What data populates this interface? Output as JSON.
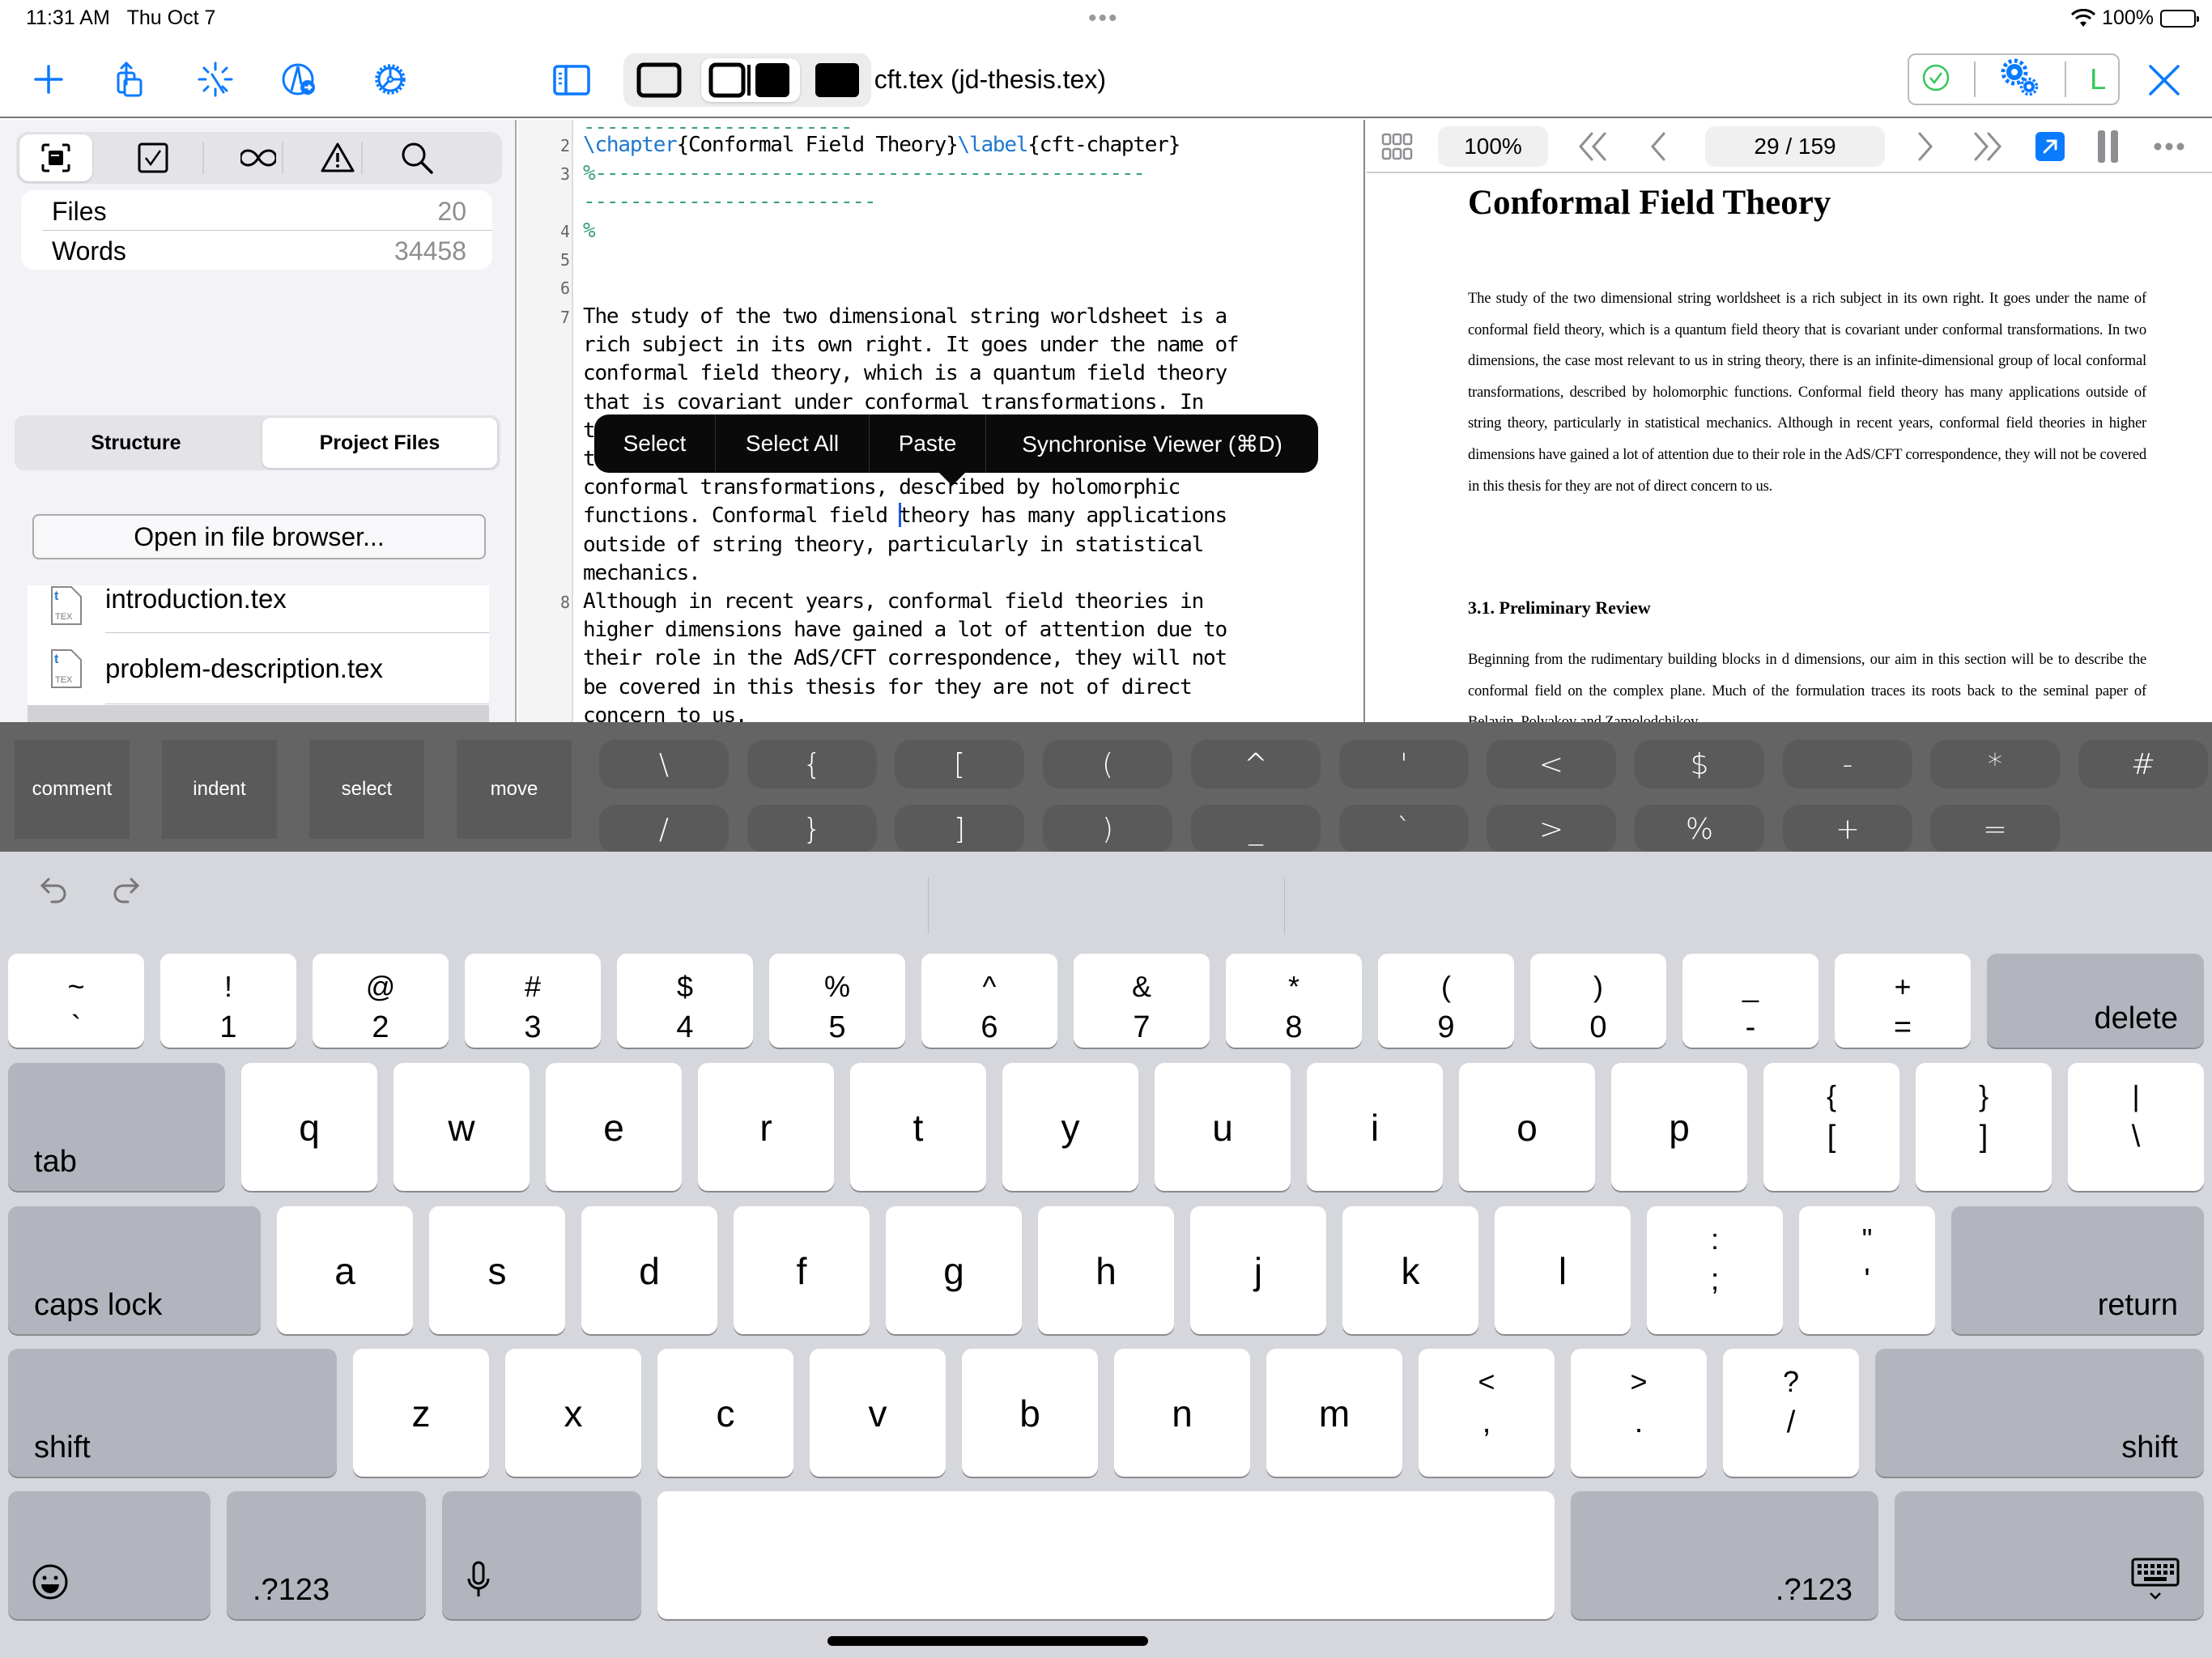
{
  "status_bar": {
    "time": "11:31 AM",
    "date": "Thu Oct 7",
    "battery": "100%",
    "multitask_dots": "•••"
  },
  "toolbar": {
    "left_icons": [
      "plus-icon",
      "share-icon",
      "magic-wand-icon",
      "compass-icon",
      "settings-gear-icon"
    ],
    "sidebar_toggle": "sidebar-icon",
    "layout_modes": [
      "editor-only",
      "split-editor-viewer",
      "viewer-only"
    ],
    "selected_layout": "split-editor-viewer",
    "title": "cft.tex (jd-thesis.tex)",
    "status_group": {
      "compile_status": "checkmark-circle-icon",
      "settings": "gears-icon",
      "engine_label": "L"
    },
    "close": "close-icon",
    "colors": {
      "accent": "#0a7aff",
      "success": "#34c759"
    }
  },
  "sidebar": {
    "segment_icons": [
      "outline-icon",
      "checkbox-icon",
      "infinity-icon",
      "warning-icon",
      "search-icon"
    ],
    "selected_segment": 0,
    "stats": [
      {
        "label": "Files",
        "value": "20"
      },
      {
        "label": "Words",
        "value": "34458"
      }
    ],
    "tabs": [
      {
        "label": "Structure",
        "selected": false
      },
      {
        "label": "Project Files",
        "selected": true
      }
    ],
    "open_button": "Open in file browser...",
    "files": [
      {
        "name": "introduction.tex",
        "icon_label": "TEX"
      },
      {
        "name": "problem-description.tex",
        "icon_label": "TEX"
      }
    ]
  },
  "editor": {
    "line_numbers": [
      "2",
      "3",
      "4",
      "5",
      "6",
      "7",
      "8"
    ],
    "line2": {
      "cmd1": "\\chapter",
      "arg1": "{Conformal Field Theory}",
      "cmd2": "\\label",
      "arg2": "{cft-chapter}"
    },
    "line3_a": "%-----------------------------------------------",
    "line3_b": "-------------------------",
    "line4": "%",
    "line7": [
      "The study of the two dimensional string worldsheet is a",
      "rich subject in its own right. It goes under the name of",
      "conformal field theory, which is a quantum field theory",
      "that is covariant under conformal transformations. In",
      "two dimensions, the case most relevant to us in string",
      "theory, there is an infinite-dimensional group of local",
      "conformal transformations, described by holomorphic"
    ],
    "line7_caret_before": "functions. Conformal field ",
    "line7_caret_after": "theory has many applications",
    "line7_rest": [
      "outside of string theory, particularly in statistical",
      "mechanics."
    ],
    "line8": [
      "Although in recent years, conformal field theories in",
      "higher dimensions have gained a lot of attention due to",
      "their role in the AdS/CFT correspondence, they will not",
      "be covered in this thesis for they are not of direct",
      "concern to us."
    ]
  },
  "context_menu": {
    "items": [
      "Select",
      "Select All",
      "Paste",
      "Synchronise Viewer (⌘D)"
    ]
  },
  "viewer": {
    "zoom": "100%",
    "page_indicator": "29 / 159",
    "nav": [
      "first-page-icon",
      "prev-page-icon",
      "next-page-icon",
      "last-page-icon"
    ],
    "page": {
      "title": "Conformal Field Theory",
      "para1": "The study of the two dimensional string worldsheet is a rich subject in its own right. It goes under the name of conformal field theory, which is a quantum field theory that is covariant under conformal transformations. In two dimensions, the case most relevant to us in string theory, there is an infinite-dimensional group of local conformal transformations, described by holomorphic functions. Conformal field theory has many applications outside of string theory, particularly in statistical mechanics. Although in recent years, conformal field theories in higher dimensions have gained a lot of attention due to their role in the AdS/CFT correspondence, they will not be covered in this thesis for they are not of direct concern to us.",
      "section": "3.1.  Preliminary Review",
      "para2": "Beginning from the rudimentary building blocks in d dimensions, our aim in this section will be to describe the conformal field on the complex plane. Much of the formulation traces its roots back to the seminal paper of Belavin, Polyakov and Zamolodchikov"
    }
  },
  "accessory_bar": {
    "tools": [
      "comment",
      "indent",
      "select",
      "move"
    ],
    "row1": [
      "\\",
      "{",
      "[",
      "(",
      "^",
      "'",
      "<",
      "$",
      "-",
      "*",
      "#"
    ],
    "row2": [
      "/",
      "}",
      "]",
      ")",
      "_",
      "`",
      ">",
      "%",
      "+",
      "="
    ]
  },
  "keyboard": {
    "number_row": [
      {
        "top": "~",
        "bot": "`"
      },
      {
        "top": "!",
        "bot": "1"
      },
      {
        "top": "@",
        "bot": "2"
      },
      {
        "top": "#",
        "bot": "3"
      },
      {
        "top": "$",
        "bot": "4"
      },
      {
        "top": "%",
        "bot": "5"
      },
      {
        "top": "^",
        "bot": "6"
      },
      {
        "top": "&",
        "bot": "7"
      },
      {
        "top": "*",
        "bot": "8"
      },
      {
        "top": "(",
        "bot": "9"
      },
      {
        "top": ")",
        "bot": "0"
      },
      {
        "top": "_",
        "bot": "-"
      },
      {
        "top": "+",
        "bot": "="
      }
    ],
    "delete": "delete",
    "tab": "tab",
    "row_q": [
      "q",
      "w",
      "e",
      "r",
      "t",
      "y",
      "u",
      "i",
      "o",
      "p"
    ],
    "row_q_sym": [
      {
        "top": "{",
        "bot": "["
      },
      {
        "top": "}",
        "bot": "]"
      },
      {
        "top": "|",
        "bot": "\\"
      }
    ],
    "caps_lock": "caps lock",
    "row_a": [
      "a",
      "s",
      "d",
      "f",
      "g",
      "h",
      "j",
      "k",
      "l"
    ],
    "row_a_sym": [
      {
        "top": ":",
        "bot": ";"
      },
      {
        "top": "\"",
        "bot": "'"
      }
    ],
    "return": "return",
    "shift": "shift",
    "row_z": [
      "z",
      "x",
      "c",
      "v",
      "b",
      "n",
      "m"
    ],
    "row_z_sym": [
      {
        "top": "<",
        "bot": ","
      },
      {
        "top": ">",
        "bot": "."
      },
      {
        "top": "?",
        "bot": "/"
      }
    ],
    "numbers_key": ".?123",
    "emoji": "emoji-icon",
    "mic": "microphone-icon",
    "dismiss": "keyboard-dismiss-icon"
  }
}
